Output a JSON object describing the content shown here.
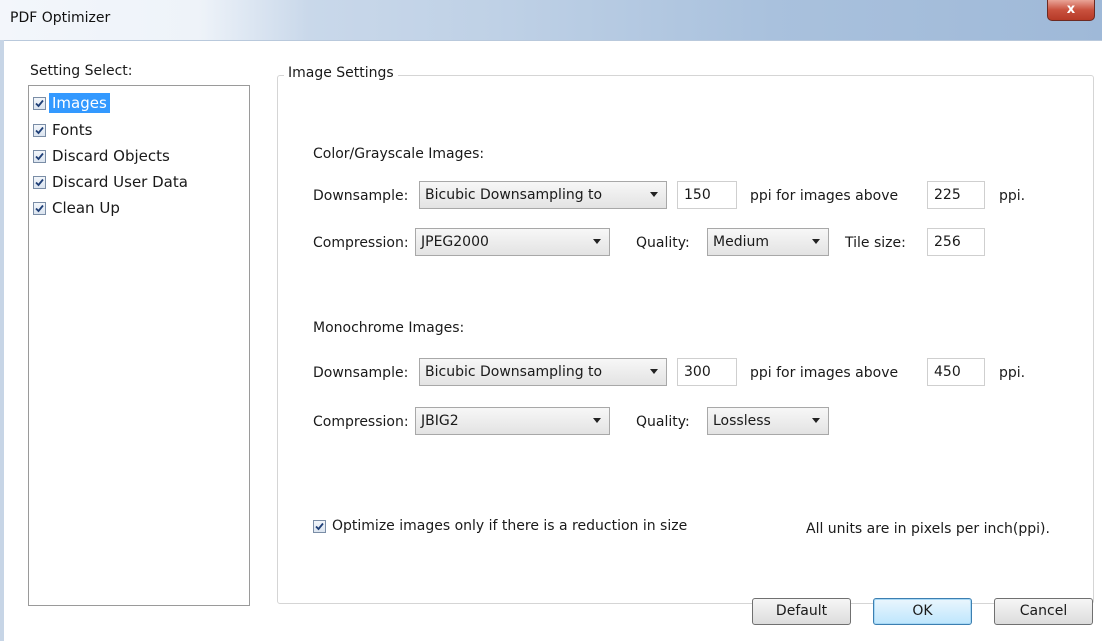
{
  "window": {
    "title": "PDF Optimizer",
    "close_label": "x"
  },
  "sidebar": {
    "heading": "Setting Select:",
    "items": [
      {
        "label": "Images",
        "checked": true,
        "selected": true
      },
      {
        "label": "Fonts",
        "checked": true,
        "selected": false
      },
      {
        "label": "Discard Objects",
        "checked": true,
        "selected": false
      },
      {
        "label": "Discard User Data",
        "checked": true,
        "selected": false
      },
      {
        "label": "Clean Up",
        "checked": true,
        "selected": false
      }
    ]
  },
  "image_settings": {
    "group_title": "Image Settings",
    "color": {
      "section_label": "Color/Grayscale Images:",
      "downsample_label": "Downsample:",
      "downsample_method": "Bicubic Downsampling to",
      "downsample_ppi": "150",
      "above_label": "ppi for images above",
      "above_ppi": "225",
      "ppi_suffix": "ppi.",
      "compression_label": "Compression:",
      "compression": "JPEG2000",
      "quality_label": "Quality:",
      "quality": "Medium",
      "tile_label": "Tile size:",
      "tile_size": "256"
    },
    "mono": {
      "section_label": "Monochrome Images:",
      "downsample_label": "Downsample:",
      "downsample_method": "Bicubic Downsampling to",
      "downsample_ppi": "300",
      "above_label": "ppi for images above",
      "above_ppi": "450",
      "ppi_suffix": "ppi.",
      "compression_label": "Compression:",
      "compression": "JBIG2",
      "quality_label": "Quality:",
      "quality": "Lossless"
    },
    "optimize_only_if_smaller": {
      "label": "Optimize images only if there is a reduction in size",
      "checked": true
    },
    "units_note": "All units are in pixels per inch(ppi)."
  },
  "buttons": {
    "default": "Default",
    "ok": "OK",
    "cancel": "Cancel"
  },
  "colors": {
    "selection": "#3399ff",
    "close_button": "#c9513e"
  }
}
